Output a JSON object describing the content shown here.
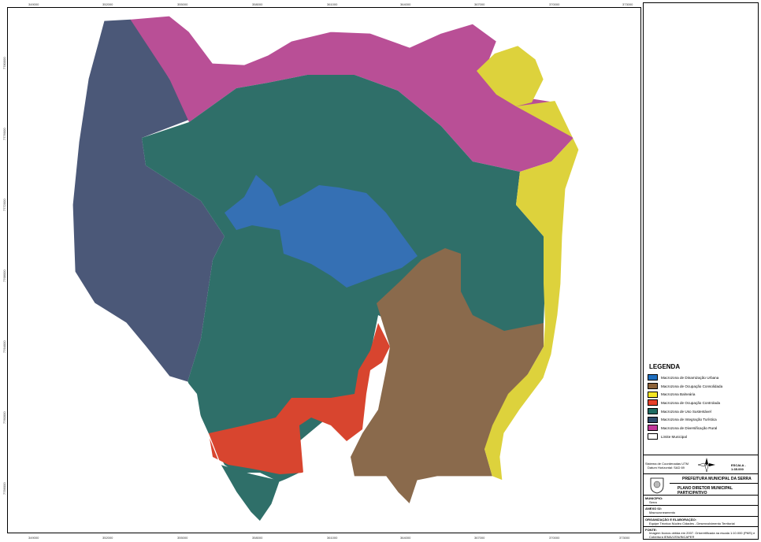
{
  "map": {
    "ticks_x": [
      "349000",
      "352000",
      "355000",
      "358000",
      "361000",
      "364000",
      "367000",
      "370000",
      "373000"
    ],
    "ticks_y": [
      "7780000",
      "7776000",
      "7772000",
      "7768000",
      "7764000",
      "7760000",
      "7756000"
    ],
    "zones": [
      {
        "id": "integracao-turistica",
        "color": "#4b5878"
      },
      {
        "id": "diversificacao-rural",
        "color": "#b94f96"
      },
      {
        "id": "uso-sustentavel",
        "color": "#2f6f69"
      },
      {
        "id": "dinamizacao-urbana",
        "color": "#3570b4"
      },
      {
        "id": "ocupacao-consolidada",
        "color": "#8a6a4c"
      },
      {
        "id": "balnearia",
        "color": "#ddd23c"
      },
      {
        "id": "ocupacao-controlada",
        "color": "#d8452f"
      }
    ]
  },
  "legend": {
    "title": "LEGENDA",
    "items": [
      {
        "label": "Macrozona de Dinamização Urbana",
        "color": "#1f6fbf"
      },
      {
        "label": "Macrozona de Ocupação Consolidada",
        "color": "#8c6239"
      },
      {
        "label": "Macrozona Balneária",
        "color": "#f5e624"
      },
      {
        "label": "Macrozona de Ocupação Controlada",
        "color": "#e8402a"
      },
      {
        "label": "Macrozona de Uso Sustentável",
        "color": "#1e6b62"
      },
      {
        "label": "Macrozona de Integração Turística",
        "color": "#2f4b6b"
      },
      {
        "label": "Macrozona de Diversificação Rural",
        "color": "#c2379a"
      },
      {
        "label": "Limite Municipal",
        "color": "#ffffff"
      }
    ]
  },
  "info": {
    "coord_system": "Sistema de Coordenadas UTM",
    "datum": "Datum Horizontal: SAD 69",
    "scale": "ESCALA - 1:35.000",
    "org": "PREFEITURA MUNICIPAL DA SERRA",
    "plan": "PLANO DIRETOR MUNICIPAL PARTICIPATIVO",
    "municipio_label": "MUNICÍPIO:",
    "municipio_value": "Serra",
    "anexo_label": "ANEXO 02:",
    "anexo_value": "Macrozoneamento",
    "org_label": "ORGANIZAÇÃO E ELABORAÇÃO:",
    "org_value": "Equipe Técnica Núcleo Cidades - Desenvolvimento Territorial",
    "fonte_label": "FONTE:",
    "fonte_value": "Imagem Ikonos obtida em 2007. Ortorretificada na escala 1:10.000 (PMS) e Cobertura IEMA/IJSN/INCAPER"
  }
}
